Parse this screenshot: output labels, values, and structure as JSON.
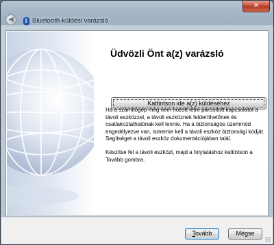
{
  "window": {
    "title": "Bluetooth-küldési varázsló",
    "close_label": "✕",
    "back_glyph": "◀"
  },
  "main": {
    "heading": "Üdvözli Önt a(z)  varázsló",
    "action_button": "Kattintson ide a(z)  küldéséhez",
    "paragraph1": "Ha a számítógép még nem hozott létre párosított kapcsolatot a távoli eszközzel, a távoli eszköznek felderíthetőnek és csatlakoztathatónak kell lennie. Ha a biztonságos üzemmód engedélyezve van, ismernie kell a távoli eszköz biztonsági kódját. Segítséget a távoli eszköz dokumentációjában talál.",
    "paragraph2": "Készítse fel a távoli eszközt, majd a folytatáshoz kattintson a Tovább gombra."
  },
  "footer": {
    "next_accel": "T",
    "next_rest": "ovább",
    "cancel_label": "Mégse"
  },
  "icons": {
    "back": "back-arrow-icon",
    "bluetooth": "bluetooth-icon",
    "close": "close-icon",
    "globe": "globe-illustration"
  }
}
